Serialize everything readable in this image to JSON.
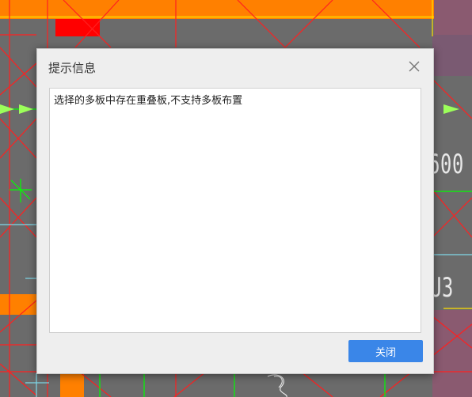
{
  "dialog": {
    "title": "提示信息",
    "message": "选择的多板中存在重叠板,不支持多板布置",
    "close_button_label": "关闭",
    "close_icon": "close-icon"
  },
  "background": {
    "labels": [
      "600",
      "U3"
    ]
  },
  "colors": {
    "accent": "#3a86e8",
    "cad_background": "#6b6b6b",
    "cad_orange": "#ff8000",
    "cad_red": "#ff0000",
    "cad_green": "#00ff00",
    "cad_cyan": "#7fd8e8"
  }
}
